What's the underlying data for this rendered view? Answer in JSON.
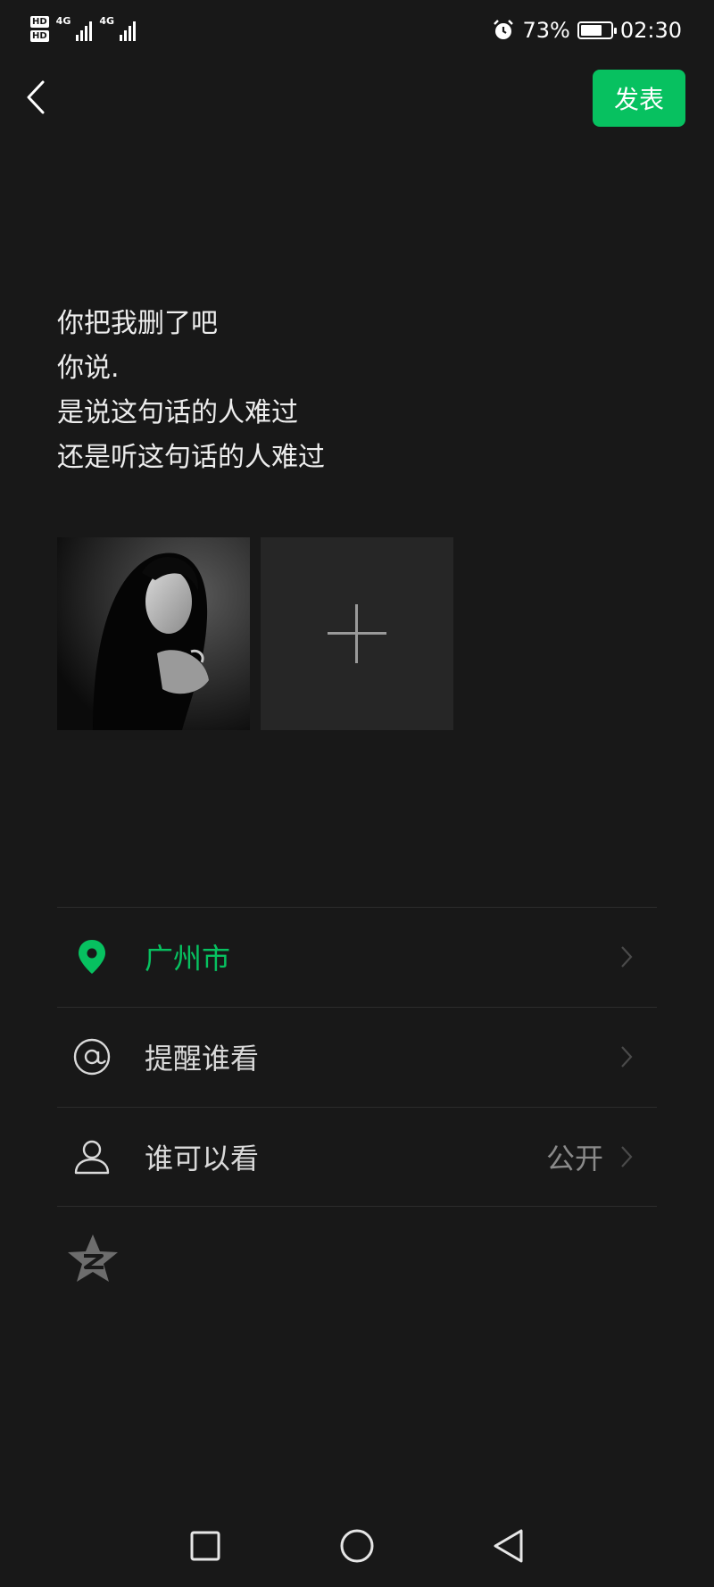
{
  "status_bar": {
    "sim1_badge": "HD",
    "sim2_badge": "HD",
    "network1": "4G",
    "network2": "4G",
    "battery_percent": "73%",
    "battery_level": 0.73,
    "time": "02:30",
    "alarm_icon": "alarm-clock-icon"
  },
  "header": {
    "back_icon": "chevron-left-icon",
    "publish_label": "发表",
    "publish_color": "#07c160"
  },
  "post": {
    "lines": [
      "你把我删了吧",
      "你说.",
      "是说这句话的人难过",
      "还是听这句话的人难过"
    ]
  },
  "images": {
    "photo_alt": "black and white photo of a woman",
    "add_icon": "plus-icon"
  },
  "options": [
    {
      "icon": "location-pin-icon",
      "label": "广州市",
      "value": "",
      "color": "#07c160"
    },
    {
      "icon": "at-sign-icon",
      "label": "提醒谁看",
      "value": ""
    },
    {
      "icon": "person-icon",
      "label": "谁可以看",
      "value": "公开"
    }
  ],
  "share": {
    "icon": "qzone-star-icon"
  },
  "nav_bar": {
    "recent_icon": "square-icon",
    "home_icon": "circle-icon",
    "back_icon": "triangle-back-icon"
  }
}
